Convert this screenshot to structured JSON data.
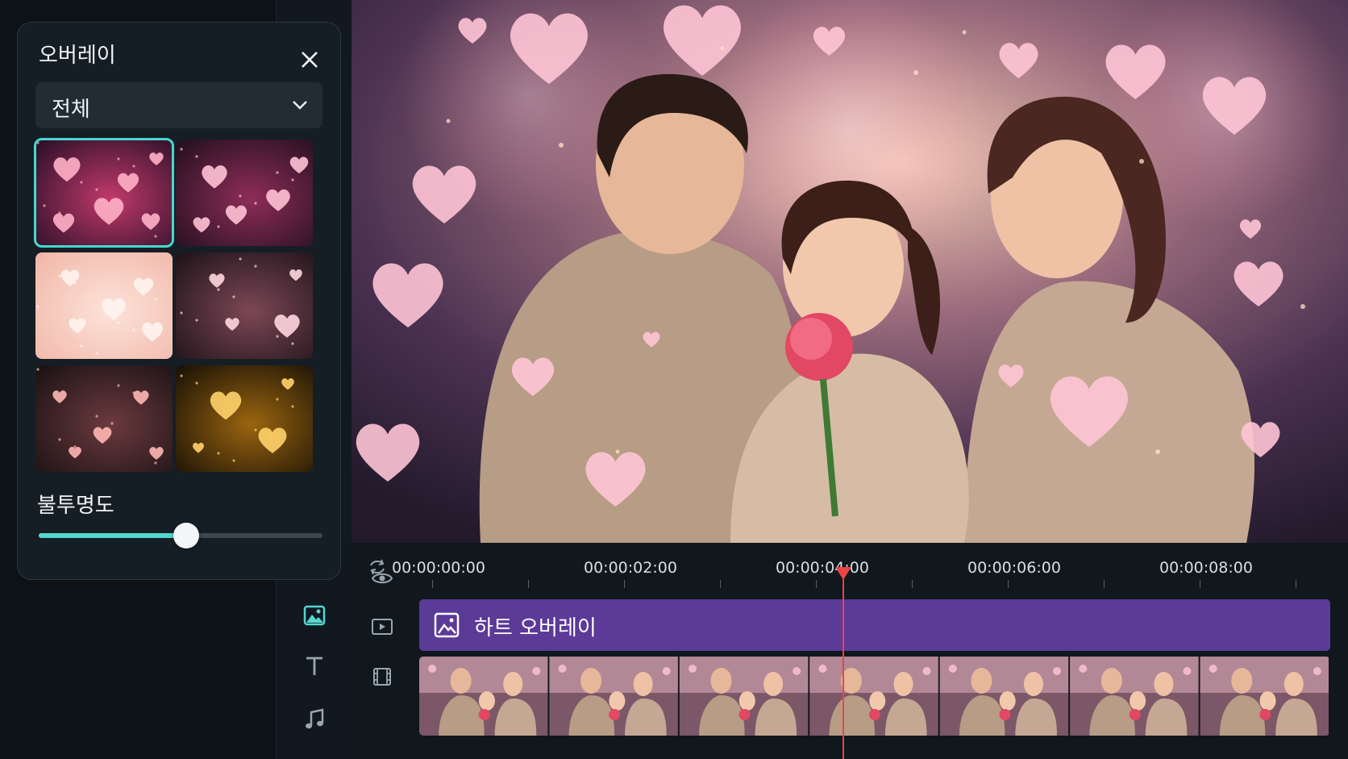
{
  "overlay_panel": {
    "title": "오버레이",
    "category_dropdown": {
      "selected": "전체"
    },
    "presets": [
      {
        "name": "hearts-pink-dark",
        "selected": true,
        "bg1": "#2b0f28",
        "bg2": "#c13a6a",
        "heart": "#ffb1c8"
      },
      {
        "name": "hearts-magenta",
        "selected": false,
        "bg1": "#24101f",
        "bg2": "#8e2d58",
        "heart": "#ffc2d6"
      },
      {
        "name": "hearts-peach-light",
        "selected": false,
        "bg1": "#f1b7a9",
        "bg2": "#fde3d9",
        "heart": "#fff3ef"
      },
      {
        "name": "hearts-soft-dusk",
        "selected": false,
        "bg1": "#1f1419",
        "bg2": "#7d4757",
        "heart": "#ffd6e0"
      },
      {
        "name": "bokeh-rose",
        "selected": false,
        "bg1": "#1b1214",
        "bg2": "#6b3a3e",
        "heart": "#ffb7b2"
      },
      {
        "name": "hearts-golden",
        "selected": false,
        "bg1": "#1a1206",
        "bg2": "#9b6510",
        "heart": "#ffd36a"
      }
    ],
    "opacity": {
      "label": "불투명도",
      "value": 0.52
    }
  },
  "tool_rail": [
    {
      "name": "overlay-tool",
      "icon": "image-icon",
      "active": true
    },
    {
      "name": "text-tool",
      "icon": "text-icon",
      "active": false
    },
    {
      "name": "audio-tool",
      "icon": "music-note-icon",
      "active": false
    }
  ],
  "timeline": {
    "timestamps": [
      "00:00:00:00",
      "00:00:02:00",
      "00:00:04:00",
      "00:00:06:00",
      "00:00:08:00"
    ],
    "playhead_time_seconds": 4.3,
    "overlay_clip_label": "하트 오버레이",
    "video_frames": 7
  },
  "colors": {
    "accent": "#47d7d0",
    "overlay_clip": "#5b3a98",
    "playhead": "#e84545"
  }
}
